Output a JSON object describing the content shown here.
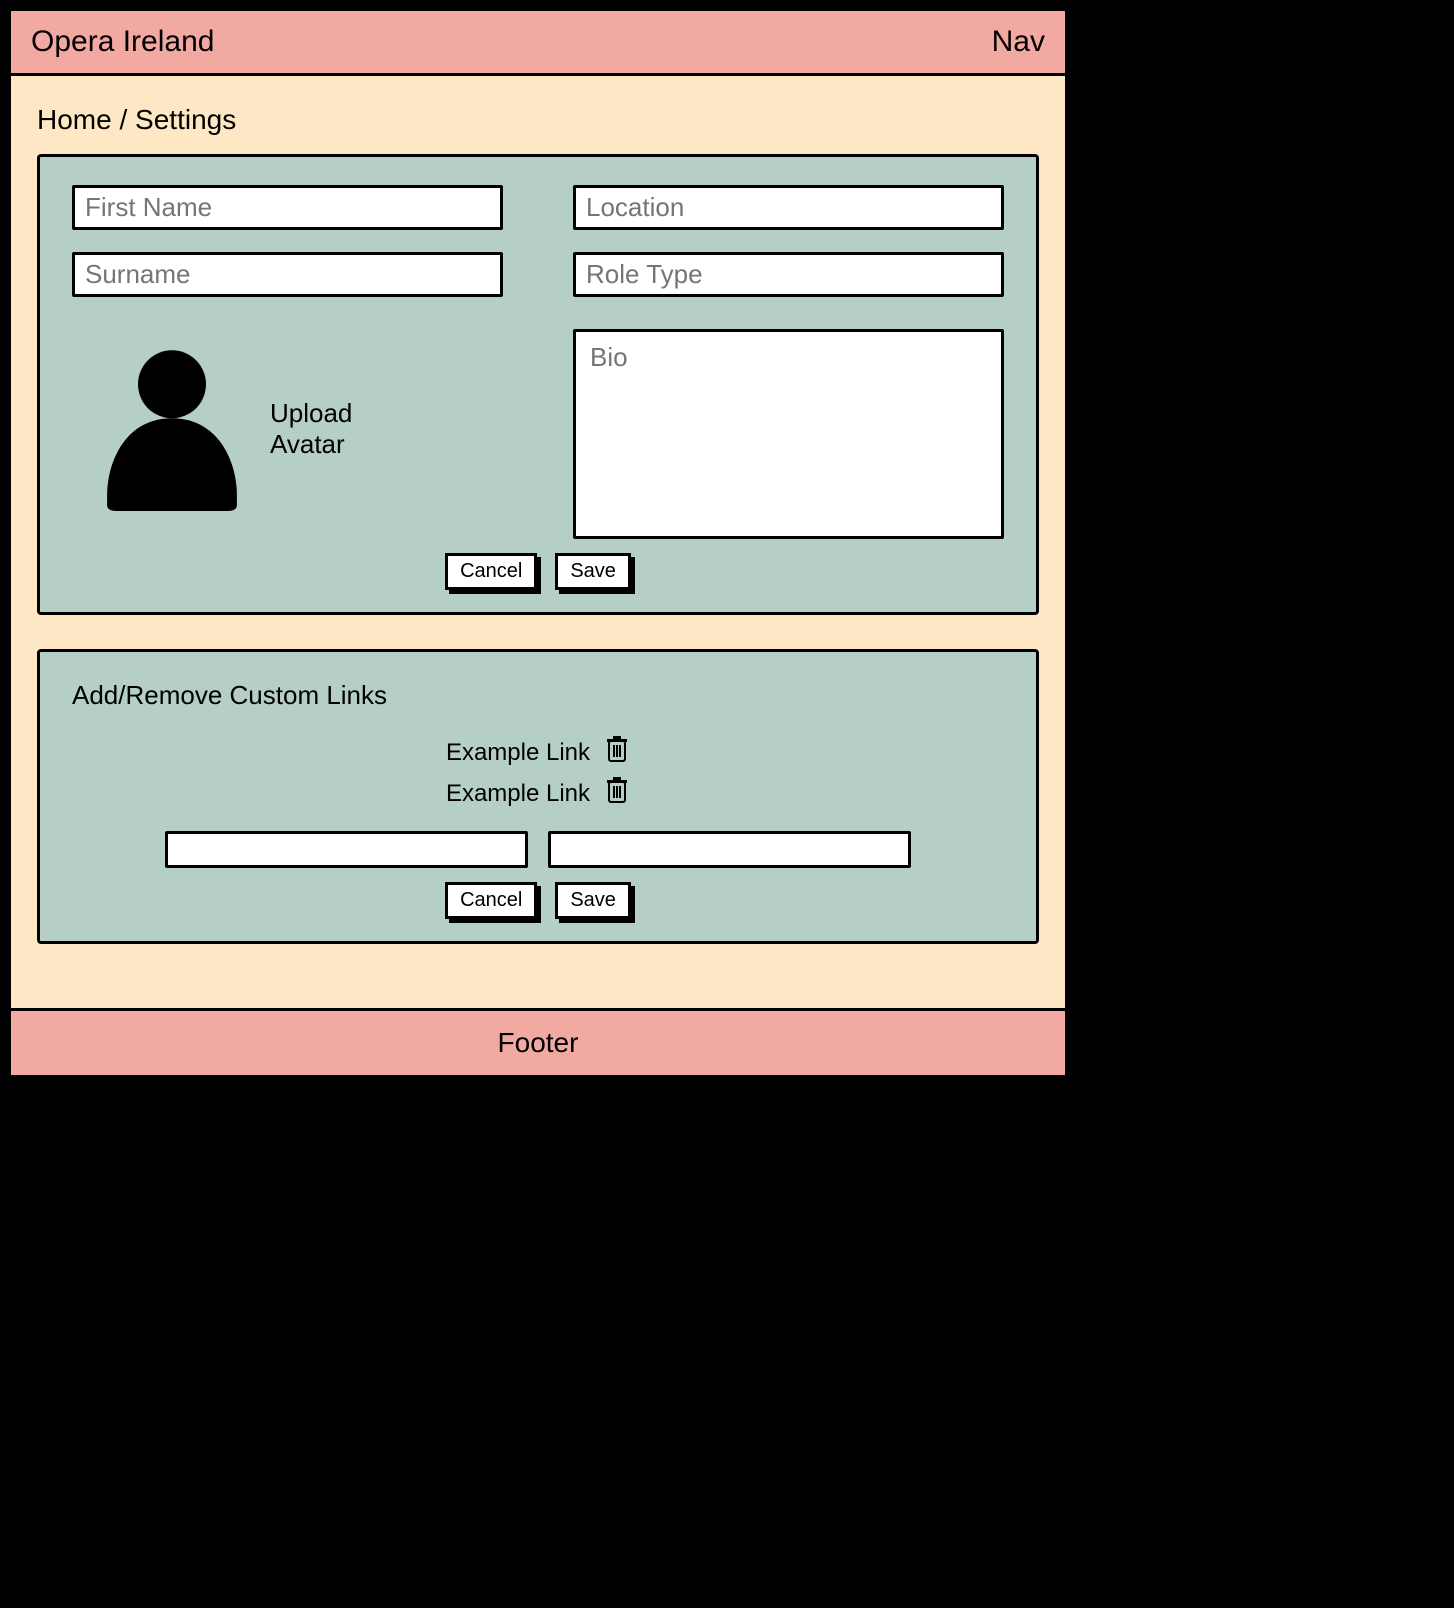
{
  "header": {
    "title": "Opera Ireland",
    "nav_label": "Nav"
  },
  "breadcrumb": {
    "home": "Home",
    "sep": " / ",
    "current": "Settings"
  },
  "profile_panel": {
    "first_name_placeholder": "First Name",
    "surname_placeholder": "Surname",
    "location_placeholder": "Location",
    "role_type_placeholder": "Role Type",
    "upload_avatar_label": "Upload Avatar",
    "bio_placeholder": "Bio",
    "cancel_label": "Cancel",
    "save_label": "Save"
  },
  "links_panel": {
    "title": "Add/Remove Custom Links",
    "links": [
      {
        "label": "Example Link"
      },
      {
        "label": "Example Link"
      }
    ],
    "input1_value": "",
    "input2_value": "",
    "cancel_label": "Cancel",
    "save_label": "Save"
  },
  "footer": {
    "label": "Footer"
  }
}
